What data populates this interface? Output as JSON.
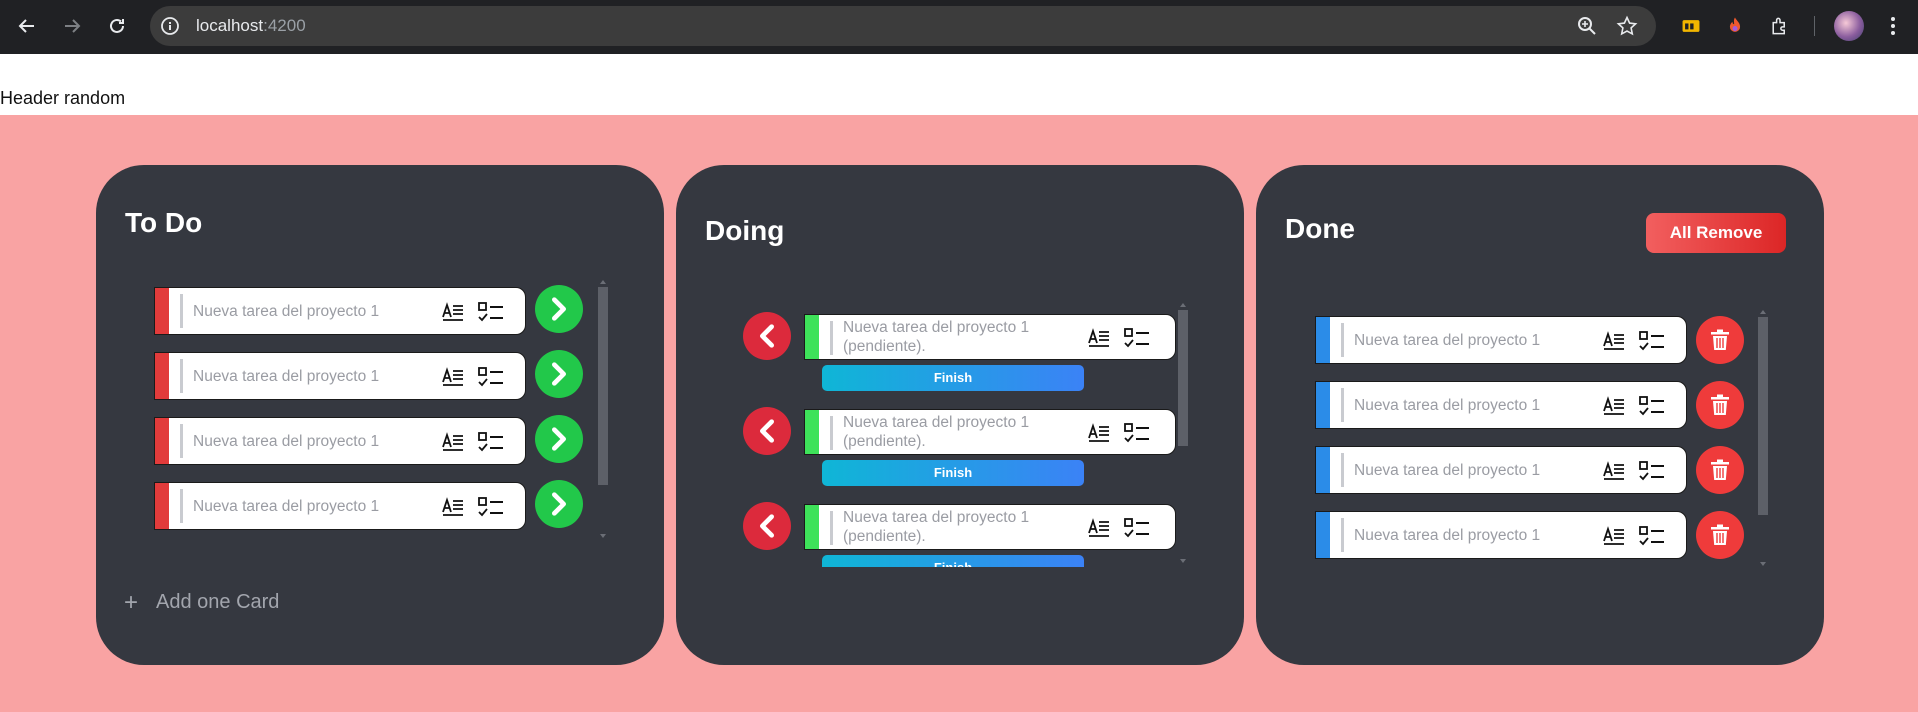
{
  "browser": {
    "url_host": "localhost",
    "url_port": ":4200"
  },
  "page": {
    "header_text": "Header random"
  },
  "colors": {
    "board_bg": "#f9a3a3",
    "column_bg": "#353840",
    "todo_stripe": "#e23b3b",
    "doing_stripe": "#3ee25a",
    "done_stripe": "#2b8ce8",
    "move_button": "#22c84a",
    "back_button": "#dc2a3c",
    "delete_button": "#ef3b3b"
  },
  "columns": {
    "todo": {
      "title": "To Do",
      "cards": [
        {
          "text": "Nueva tarea del proyecto 1"
        },
        {
          "text": "Nueva tarea del proyecto 1"
        },
        {
          "text": "Nueva tarea del proyecto 1"
        },
        {
          "text": "Nueva tarea del proyecto 1"
        }
      ],
      "add_label": "Add one Card",
      "icons": [
        "text-format-icon",
        "checklist-icon",
        "chevron-right-icon",
        "plus-icon"
      ]
    },
    "doing": {
      "title": "Doing",
      "cards": [
        {
          "text": "Nueva tarea del proyecto 1 (pendiente).",
          "button": "Finish"
        },
        {
          "text": "Nueva tarea del proyecto 1 (pendiente).",
          "button": "Finish"
        },
        {
          "text": "Nueva tarea del proyecto 1 (pendiente).",
          "button": "Finish"
        }
      ],
      "icons": [
        "text-format-icon",
        "checklist-icon",
        "chevron-left-icon"
      ]
    },
    "done": {
      "title": "Done",
      "remove_all_label": "All Remove",
      "cards": [
        {
          "text": "Nueva tarea del proyecto 1"
        },
        {
          "text": "Nueva tarea del proyecto 1"
        },
        {
          "text": "Nueva tarea del proyecto 1"
        },
        {
          "text": "Nueva tarea del proyecto 1"
        }
      ],
      "icons": [
        "text-format-icon",
        "checklist-icon",
        "trash-icon"
      ]
    }
  }
}
